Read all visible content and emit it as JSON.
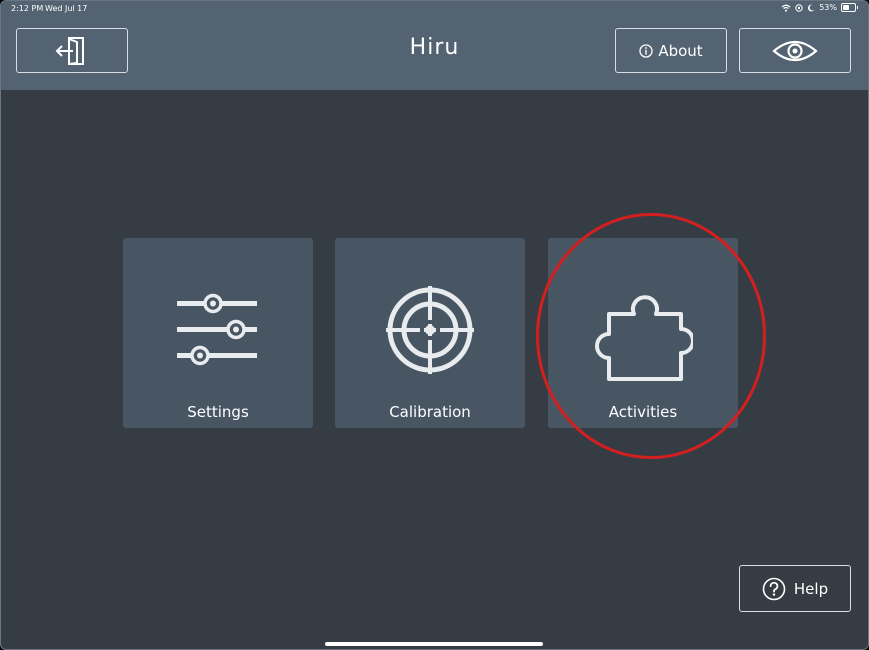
{
  "status_bar": {
    "time": "2:12 PM",
    "date": "Wed Jul 17",
    "battery": "53%"
  },
  "header": {
    "title": "Hiru",
    "exit_icon": "exit-door-icon",
    "about_label": "About",
    "about_icon": "info-icon",
    "eye_icon": "eye-icon"
  },
  "tiles": [
    {
      "label": "Settings",
      "icon": "sliders-icon"
    },
    {
      "label": "Calibration",
      "icon": "target-icon"
    },
    {
      "label": "Activities",
      "icon": "puzzle-piece-icon"
    }
  ],
  "help": {
    "label": "Help",
    "icon": "question-icon"
  },
  "colors": {
    "background": "#353c44",
    "header": "#536372",
    "tile": "#485664",
    "highlight": "#d41f1f"
  }
}
